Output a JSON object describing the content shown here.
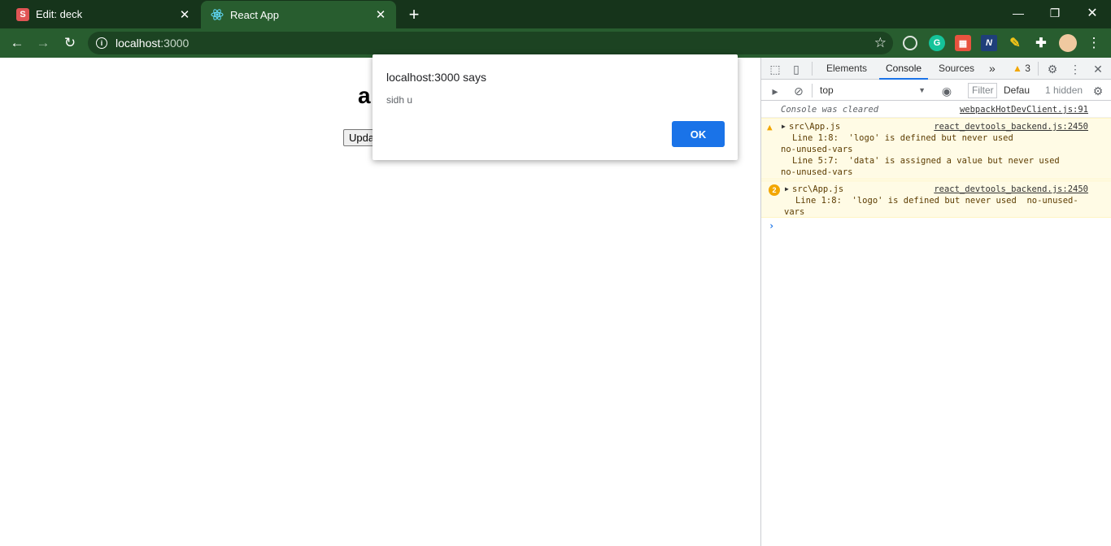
{
  "browser": {
    "tabs": [
      {
        "title": "Edit: deck",
        "favicon_letter": "S"
      },
      {
        "title": "React App"
      }
    ],
    "new_tab_label": "+",
    "url_host": "localhost",
    "url_port": ":3000"
  },
  "page": {
    "heading": "a",
    "button_label": "Upda"
  },
  "dialog": {
    "title": "localhost:3000 says",
    "message": "sidh u",
    "ok_label": "OK"
  },
  "devtools": {
    "tabs": [
      "Elements",
      "Console",
      "Sources"
    ],
    "more_tabs": "»",
    "warning_count": "3",
    "context": "top",
    "filter_placeholder": "Filter",
    "levels": "Defau",
    "hidden_count": "1 hidden",
    "messages": {
      "cleared": "Console was cleared",
      "cleared_source": "webpackHotDevClient.js:91",
      "warn1": {
        "file": "src\\App.js",
        "source": "react_devtools_backend.js:2450",
        "lines": [
          "Line 1:8:  'logo' is defined but never used",
          "no-unused-vars",
          "Line 5:7:  'data' is assigned a value but never used",
          "no-unused-vars"
        ]
      },
      "warn2": {
        "repeat": "2",
        "file": "src\\App.js",
        "source": "react_devtools_backend.js:2450",
        "lines": [
          "Line 1:8:  'logo' is defined but never used  no-unused-",
          "vars"
        ]
      }
    }
  },
  "colors": {
    "tab_strip": "#16341b",
    "toolbar": "#285d2f",
    "accent_blue": "#1a73e8",
    "warning": "#f2a600"
  }
}
